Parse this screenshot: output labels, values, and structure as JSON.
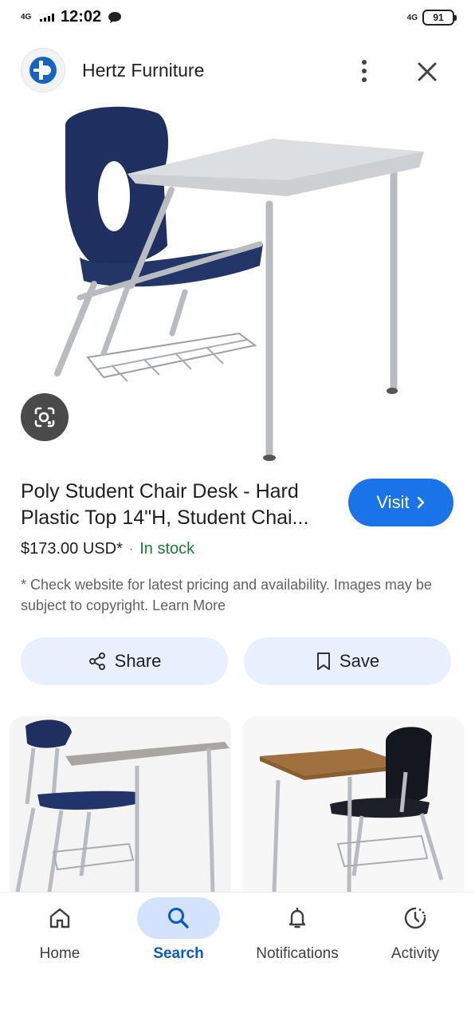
{
  "status_bar": {
    "network_left": "4G",
    "time": "12:02",
    "network_right": "4G",
    "battery": "91"
  },
  "header": {
    "site_name": "Hertz Furniture",
    "logo_icon": "hertz-logo-icon",
    "more_icon": "more-vert-icon",
    "close_icon": "close-icon"
  },
  "product": {
    "title": "Poly Student Chair Desk - Hard Plastic Top 14\"H, Student Chai...",
    "visit_label": "Visit",
    "price": "$173.00 USD*",
    "separator": "·",
    "stock": "In stock",
    "disclaimer": "* Check website for latest pricing and availability. Images may be subject to copyright. Learn More"
  },
  "actions": {
    "share_label": "Share",
    "save_label": "Save"
  },
  "colors": {
    "accent": "#1a73e8",
    "stock_green": "#188038",
    "chip_bg": "#e8f0fe",
    "nav_active_bg": "#d3e3fd"
  },
  "bottom_nav": {
    "items": [
      {
        "label": "Home",
        "icon": "home-icon"
      },
      {
        "label": "Search",
        "icon": "search-icon",
        "active": true
      },
      {
        "label": "Notifications",
        "icon": "bell-icon"
      },
      {
        "label": "Activity",
        "icon": "activity-icon"
      }
    ]
  }
}
